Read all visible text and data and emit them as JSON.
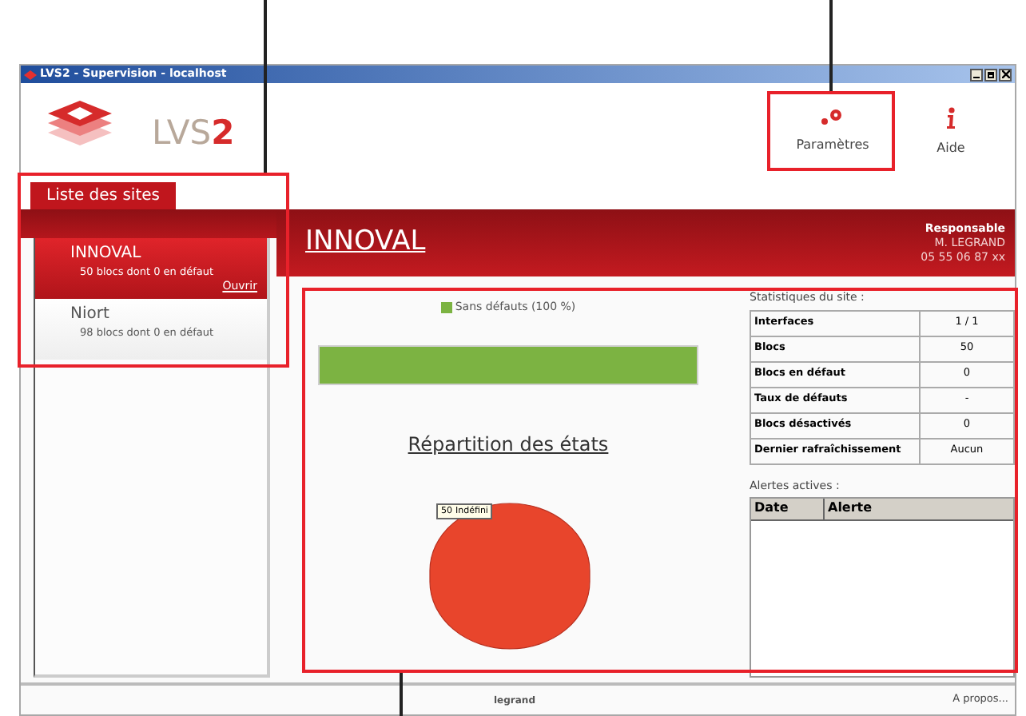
{
  "window": {
    "title": "LVS2 - Supervision - localhost"
  },
  "logo": {
    "text": "LVS",
    "accent": "2"
  },
  "toolbar": [
    {
      "kind": "settings",
      "label": "Paramètres"
    },
    {
      "kind": "info",
      "label": "Aide"
    }
  ],
  "tab": {
    "label": "Liste des sites",
    "selected": true
  },
  "sites": [
    {
      "name": "INNOVAL",
      "detail": "50 blocs dont 0 en défaut",
      "action": "Ouvrir",
      "selected": true
    },
    {
      "name": "Niort",
      "detail": "98 blocs dont 0 en défaut",
      "selected": false
    }
  ],
  "site_header": {
    "title": "INNOVAL",
    "contact_label": "Responsable",
    "contact_name": "M. LEGRAND",
    "contact_phone": "05 55 06 87 xx"
  },
  "defect_bar": {
    "legend": "Sans défauts (100 %)",
    "color": "#7cb342",
    "level": 1
  },
  "chart_data": {
    "type": "pie",
    "title": "Répartition des états",
    "categories": [
      "Indéfini"
    ],
    "values": [
      50
    ],
    "data_labels": true
  },
  "stats": {
    "title": "Statistiques du site :",
    "rows": [
      {
        "label": "Interfaces",
        "value": "1 / 1"
      },
      {
        "label": "Blocs",
        "value": "50"
      },
      {
        "label": "Blocs en défaut",
        "value": "0"
      },
      {
        "label": "Taux de défauts",
        "value": "-"
      },
      {
        "label": "Blocs désactivés",
        "value": "0"
      },
      {
        "label": "Dernier rafraîchissement",
        "value": "Aucun"
      }
    ]
  },
  "alerts": {
    "title": "Alertes actives :",
    "columns": [
      "Date",
      "Alerte"
    ]
  },
  "footer": {
    "brand": "legrand",
    "about": "A propos..."
  }
}
